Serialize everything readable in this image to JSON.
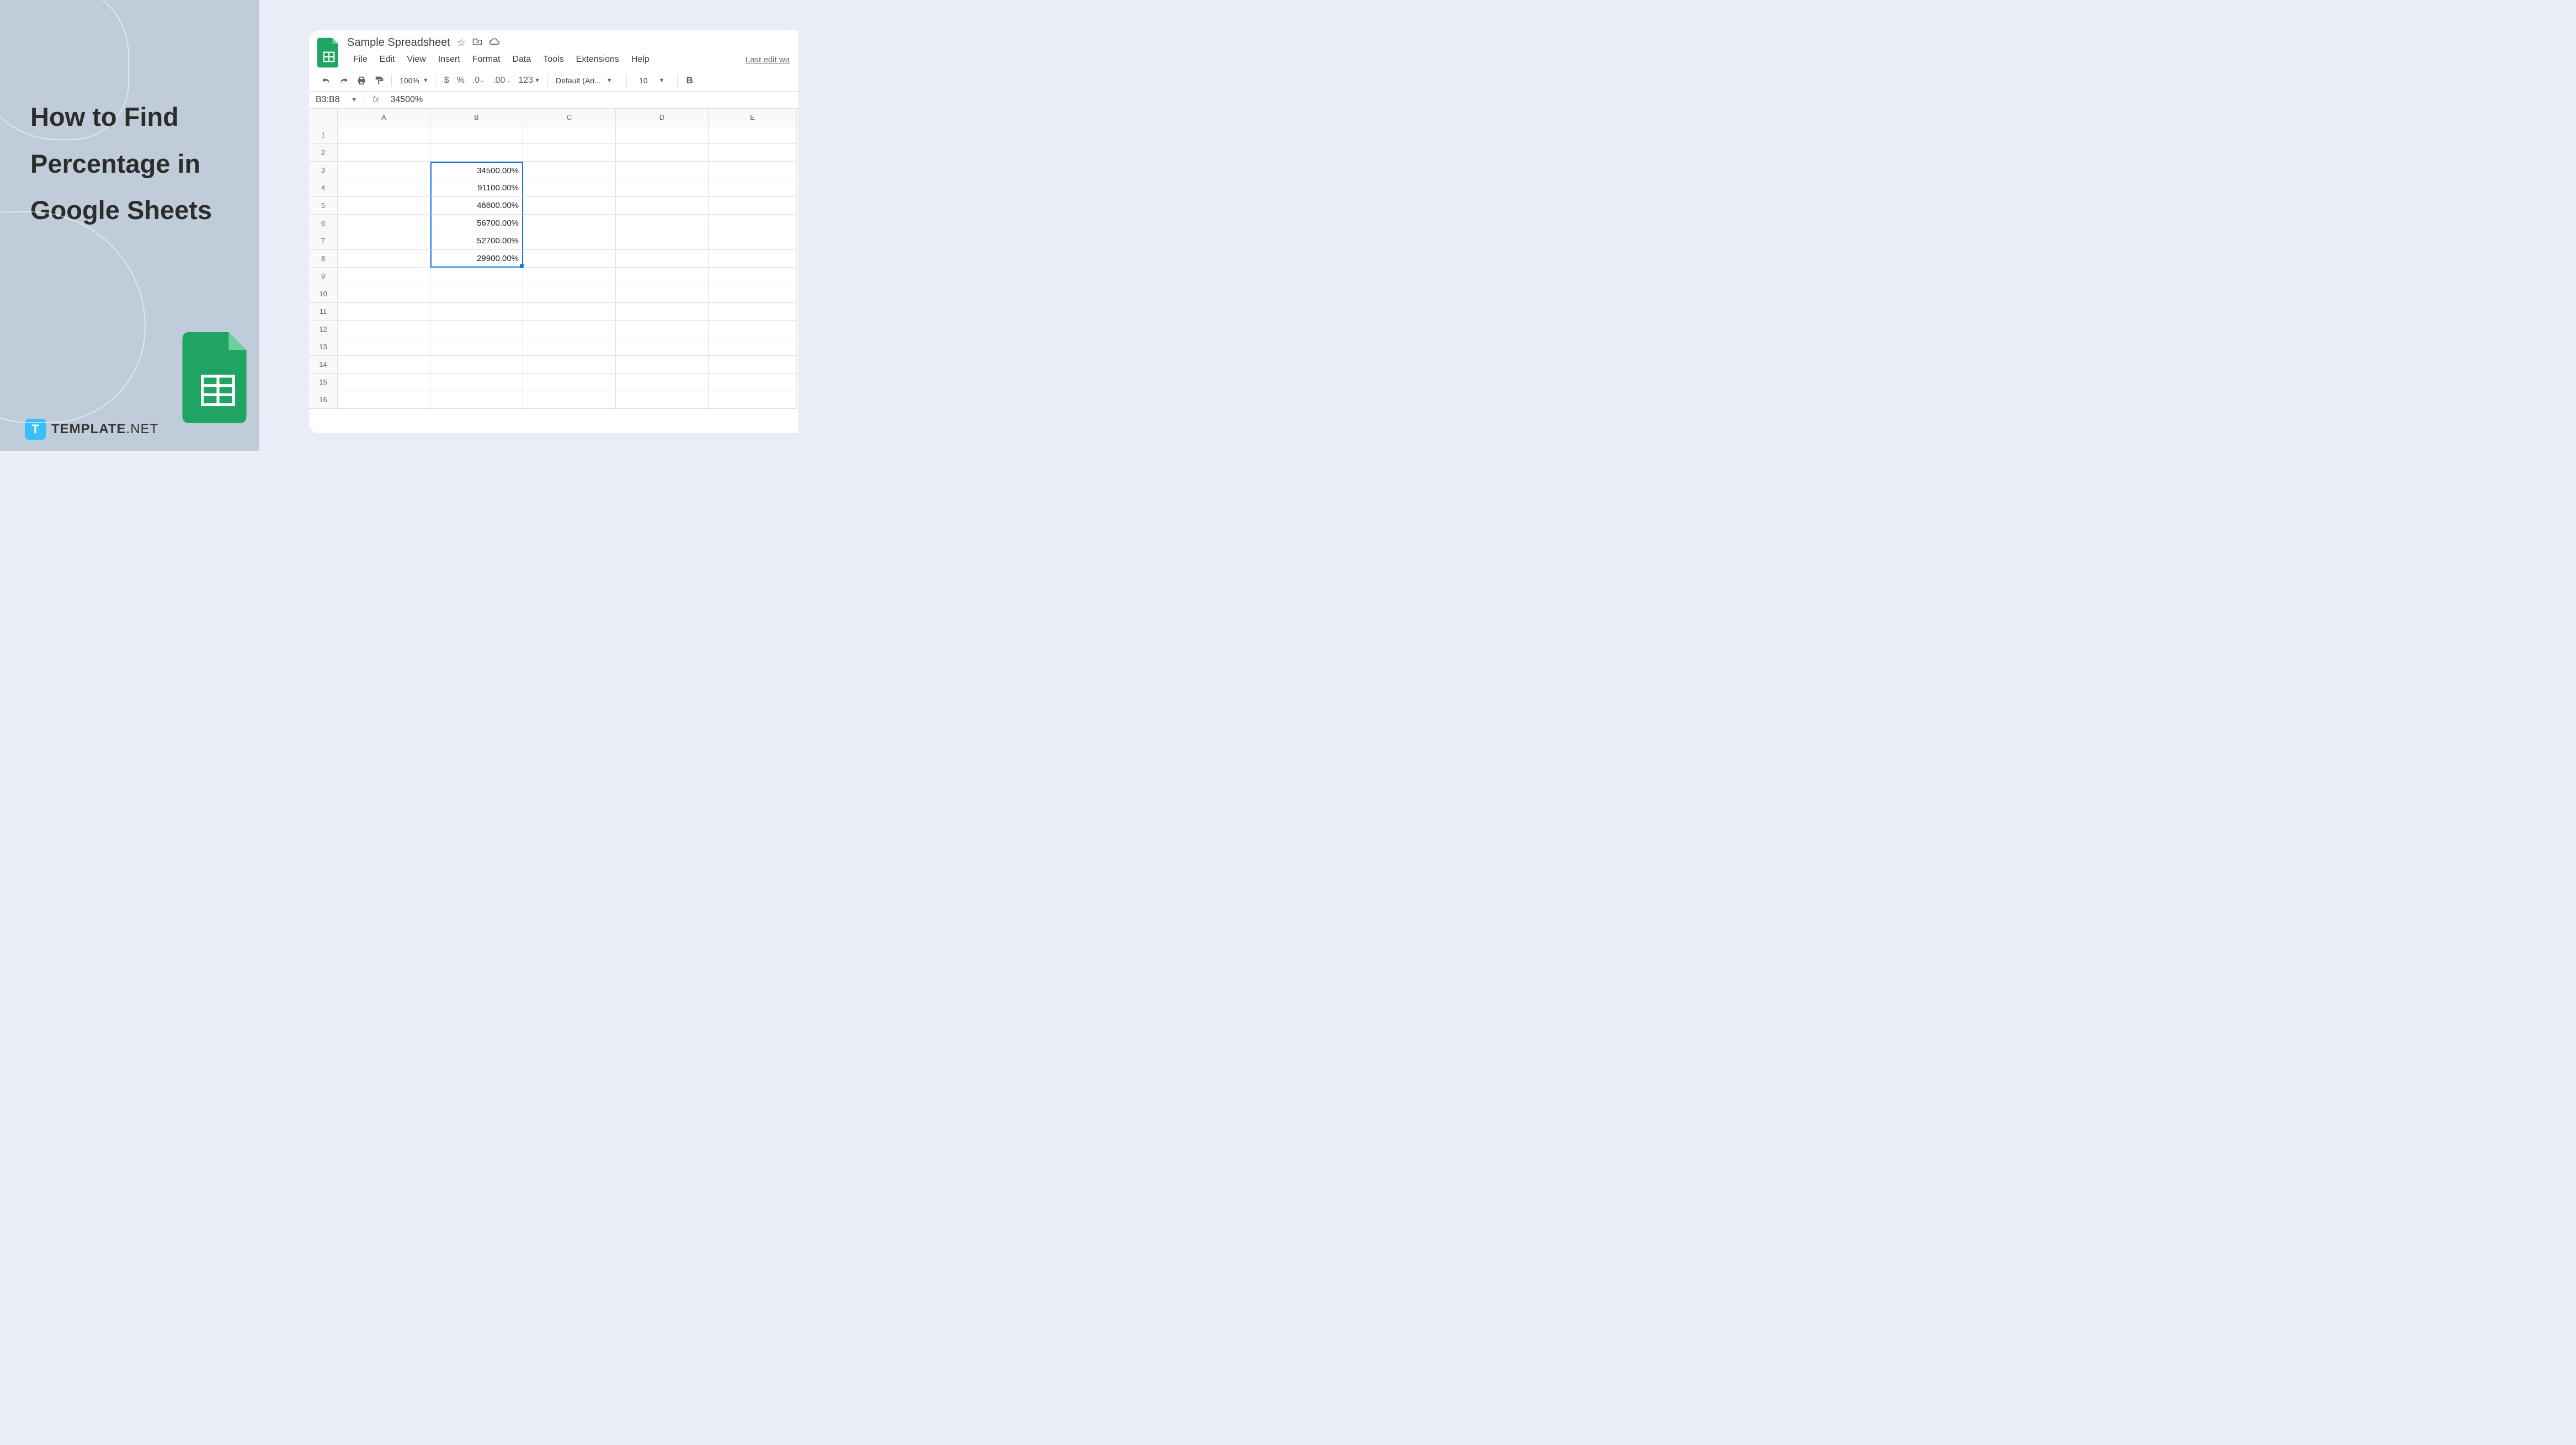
{
  "left": {
    "title": "How to Find Percentage in Google Sheets",
    "brand": "TEMPLATE",
    "brand_suffix": ".NET"
  },
  "doc": {
    "title": "Sample Spreadsheet"
  },
  "menu": {
    "file": "File",
    "edit": "Edit",
    "view": "View",
    "insert": "Insert",
    "format": "Format",
    "data": "Data",
    "tools": "Tools",
    "extensions": "Extensions",
    "help": "Help",
    "last_edit": "Last edit wa"
  },
  "toolbar": {
    "zoom": "100%",
    "dollar": "$",
    "percent": "%",
    "dec_less": ".0",
    "dec_more": ".00",
    "format_123": "123",
    "font": "Default (Ari...",
    "font_size": "10",
    "bold": "B"
  },
  "namebox": {
    "range": "B3:B8",
    "formula": "34500%"
  },
  "columns": [
    "A",
    "B",
    "C",
    "D",
    "E"
  ],
  "rows": [
    "1",
    "2",
    "3",
    "4",
    "5",
    "6",
    "7",
    "8",
    "9",
    "10",
    "11",
    "12",
    "13",
    "14",
    "15",
    "16"
  ],
  "cells": {
    "b3": "34500.00%",
    "b4": "91100.00%",
    "b5": "46600.00%",
    "b6": "56700.00%",
    "b7": "52700.00%",
    "b8": "29900.00%"
  }
}
